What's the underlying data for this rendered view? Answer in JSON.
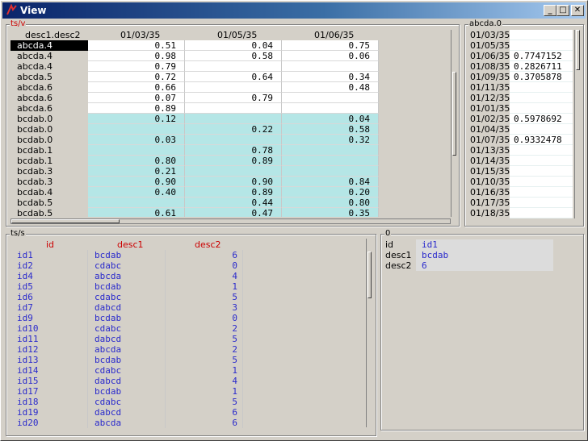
{
  "window": {
    "title": "View",
    "btn_min": "_",
    "btn_max": "□",
    "btn_close": "✕"
  },
  "top_panel": {
    "label": "ts/v"
  },
  "grid": {
    "headers": [
      "desc1.desc2",
      "01/03/35",
      "01/05/35",
      "01/06/35"
    ],
    "rows": [
      [
        "abcda.4",
        "0.51",
        "0.04",
        "0.75"
      ],
      [
        "abcda.4",
        "0.98",
        "0.58",
        "0.06"
      ],
      [
        "abcda.4",
        "0.79",
        "",
        ""
      ],
      [
        "abcda.5",
        "0.72",
        "0.64",
        "0.34"
      ],
      [
        "abcda.6",
        "0.66",
        "",
        "0.48"
      ],
      [
        "abcda.6",
        "0.07",
        "0.79",
        ""
      ],
      [
        "abcda.6",
        "0.89",
        "",
        ""
      ],
      [
        "bcdab.0",
        "0.12",
        "",
        "0.04"
      ],
      [
        "bcdab.0",
        "",
        "0.22",
        "0.58"
      ],
      [
        "bcdab.0",
        "0.03",
        "",
        "0.32"
      ],
      [
        "bcdab.1",
        "",
        "0.78",
        ""
      ],
      [
        "bcdab.1",
        "0.80",
        "0.89",
        ""
      ],
      [
        "bcdab.3",
        "0.21",
        "",
        ""
      ],
      [
        "bcdab.3",
        "0.90",
        "0.90",
        "0.84"
      ],
      [
        "bcdab.4",
        "0.40",
        "0.89",
        "0.20"
      ],
      [
        "bcdab.5",
        "",
        "0.44",
        "0.80"
      ],
      [
        "bcdab.5",
        "0.61",
        "0.47",
        "0.35"
      ]
    ]
  },
  "right_panel": {
    "label": "abcda.0",
    "rows": [
      [
        "01/03/35",
        ""
      ],
      [
        "01/05/35",
        ""
      ],
      [
        "01/06/35",
        "0.7747152"
      ],
      [
        "01/08/35",
        "0.2826711"
      ],
      [
        "01/09/35",
        "0.3705878"
      ],
      [
        "01/11/35",
        ""
      ],
      [
        "01/12/35",
        ""
      ],
      [
        "01/01/35",
        ""
      ],
      [
        "01/02/35",
        "0.5978692"
      ],
      [
        "01/04/35",
        ""
      ],
      [
        "01/07/35",
        "0.9332478"
      ],
      [
        "01/13/35",
        ""
      ],
      [
        "01/14/35",
        ""
      ],
      [
        "01/15/35",
        ""
      ],
      [
        "01/10/35",
        ""
      ],
      [
        "01/16/35",
        ""
      ],
      [
        "01/17/35",
        ""
      ],
      [
        "01/18/35",
        ""
      ]
    ]
  },
  "bottom_panel": {
    "label": "ts/s",
    "headers": [
      "id",
      "desc1",
      "desc2"
    ],
    "rows": [
      [
        "id1",
        "bcdab",
        "6"
      ],
      [
        "id2",
        "cdabc",
        "0"
      ],
      [
        "id4",
        "abcda",
        "4"
      ],
      [
        "id5",
        "bcdab",
        "1"
      ],
      [
        "id6",
        "cdabc",
        "5"
      ],
      [
        "id7",
        "dabcd",
        "3"
      ],
      [
        "id9",
        "bcdab",
        "0"
      ],
      [
        "id10",
        "cdabc",
        "2"
      ],
      [
        "id11",
        "dabcd",
        "5"
      ],
      [
        "id12",
        "abcda",
        "2"
      ],
      [
        "id13",
        "bcdab",
        "5"
      ],
      [
        "id14",
        "cdabc",
        "1"
      ],
      [
        "id15",
        "dabcd",
        "4"
      ],
      [
        "id17",
        "bcdab",
        "1"
      ],
      [
        "id18",
        "cdabc",
        "5"
      ],
      [
        "id19",
        "dabcd",
        "6"
      ],
      [
        "id20",
        "abcda",
        "6"
      ]
    ]
  },
  "detail_panel": {
    "label": "0",
    "rows": [
      [
        "id",
        "id1"
      ],
      [
        "desc1",
        "bcdab"
      ],
      [
        "desc2",
        "6"
      ]
    ]
  }
}
